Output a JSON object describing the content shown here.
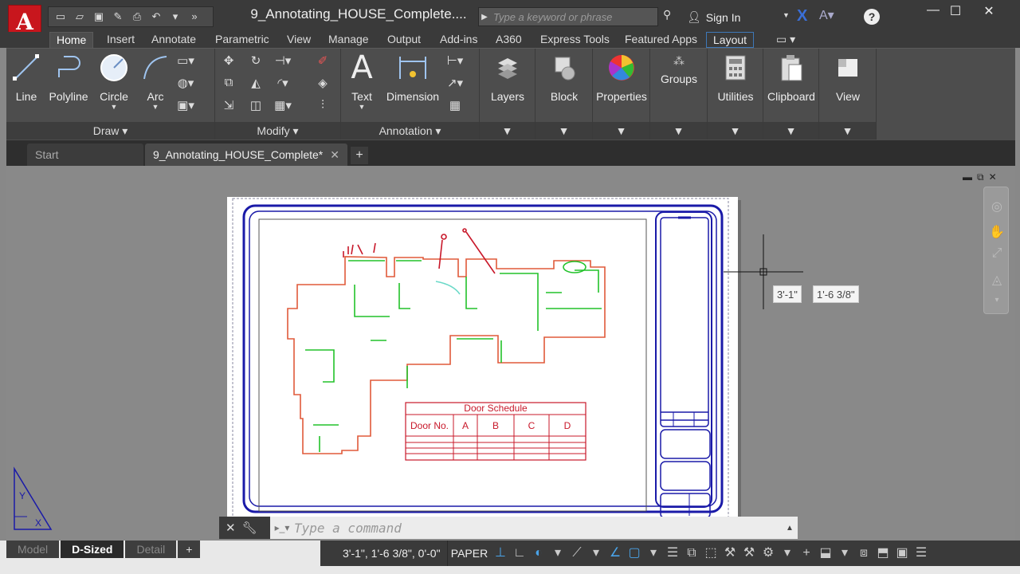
{
  "app": {
    "logo": "A",
    "title": "9_Annotating_HOUSE_Complete...."
  },
  "qat": {
    "icons": [
      "new-icon",
      "open-icon",
      "save-icon",
      "saveas-icon",
      "print-icon",
      "undo-icon",
      "undo-dropdown-icon",
      "more-icon"
    ],
    "glyphs": [
      "▭",
      "▱",
      "▣",
      "✎",
      "⎙",
      "↶",
      "▾",
      "»"
    ]
  },
  "search": {
    "placeholder": "Type a keyword or phrase"
  },
  "signin": {
    "label": "Sign In"
  },
  "window": {
    "minimize": "—",
    "maximize": "☐",
    "close": "✕"
  },
  "ribbon_tabs": [
    {
      "label": "Home",
      "active": true
    },
    {
      "label": "Insert"
    },
    {
      "label": "Annotate"
    },
    {
      "label": "Parametric"
    },
    {
      "label": "View"
    },
    {
      "label": "Manage"
    },
    {
      "label": "Output"
    },
    {
      "label": "Add-ins"
    },
    {
      "label": "A360"
    },
    {
      "label": "Express Tools"
    },
    {
      "label": "Featured Apps"
    },
    {
      "label": "Layout"
    }
  ],
  "panels": {
    "draw": {
      "title": "Draw ▾",
      "line": "Line",
      "polyline": "Polyline",
      "circle": "Circle",
      "arc": "Arc"
    },
    "modify": {
      "title": "Modify ▾"
    },
    "annotation": {
      "title": "Annotation ▾",
      "text": "Text",
      "dimension": "Dimension"
    },
    "layers": "Layers",
    "block": "Block",
    "properties": "Properties",
    "groups": "Groups",
    "utilities": "Utilities",
    "clipboard": "Clipboard",
    "view": "View"
  },
  "file_tabs": {
    "start": "Start",
    "doc": "9_Annotating_HOUSE_Complete*",
    "close": "✕",
    "add": "+"
  },
  "tooltip": {
    "x": "3'-1\"",
    "y": "1'-6 3/8\""
  },
  "door_schedule": {
    "title": "Door Schedule",
    "headers": [
      "Door No.",
      "A",
      "B",
      "C",
      "D"
    ]
  },
  "command": {
    "placeholder": "Type a command"
  },
  "layout_tabs": [
    {
      "label": "Model"
    },
    {
      "label": "D-Sized",
      "active": true
    },
    {
      "label": "Detail"
    },
    {
      "label": "+"
    }
  ],
  "status": {
    "coords": "3'-1\", 1'-6 3/8\", 0'-0\"",
    "space": "PAPER"
  },
  "colors": {
    "border_blue": "#1a1aa8",
    "wall_red": "#e05a3a",
    "wall_green": "#22c22a",
    "table_red": "#c8182a",
    "app_red": "#c8161d"
  }
}
